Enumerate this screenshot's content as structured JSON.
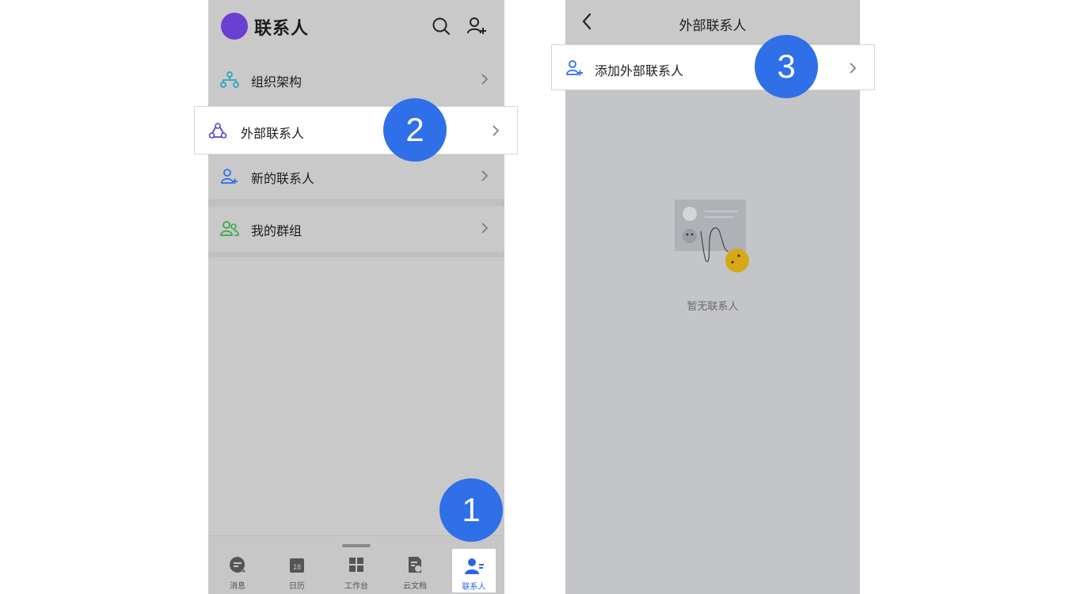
{
  "left": {
    "header": {
      "title": "联系人",
      "search_icon": "search-icon",
      "add_contact_icon": "add-person-icon"
    },
    "rows": [
      {
        "label": "组织架构",
        "icon": "org-chart-icon",
        "color": "#2aa5b8"
      },
      {
        "label": "外部联系人",
        "icon": "external-contacts-icon",
        "color": "#5a46c9"
      },
      {
        "label": "新的联系人",
        "icon": "new-contact-icon",
        "color": "#2f6fe8"
      },
      {
        "label": "我的群组",
        "icon": "group-icon",
        "color": "#3aa84a"
      }
    ],
    "tabs": [
      {
        "label": "消息",
        "icon": "message-icon"
      },
      {
        "label": "日历",
        "icon": "calendar-icon",
        "date": "18"
      },
      {
        "label": "工作台",
        "icon": "workbench-icon"
      },
      {
        "label": "云文档",
        "icon": "cloud-doc-icon"
      },
      {
        "label": "联系人",
        "icon": "contacts-icon",
        "active": true
      }
    ],
    "accent_color": "#2a64e6"
  },
  "right": {
    "header": {
      "title": "外部联系人"
    },
    "add_row": {
      "label": "添加外部联系人",
      "icon": "add-person-icon"
    },
    "empty_text": "暂无联系人"
  },
  "badges": [
    "1",
    "2",
    "3"
  ],
  "badge_color": "#2f6fe8"
}
